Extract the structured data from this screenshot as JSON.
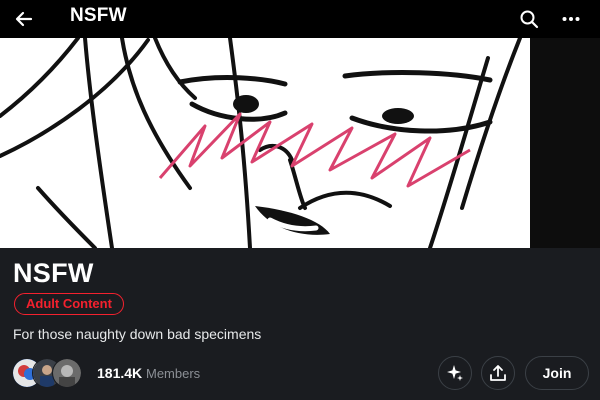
{
  "header": {
    "title": "NSFW",
    "back_icon": "arrow-left-icon",
    "search_icon": "search-icon",
    "more_icon": "more-horizontal-icon"
  },
  "community": {
    "name": "NSFW",
    "badge": "Adult Content",
    "description": "For those naughty down bad specimens",
    "member_count": "181.4K",
    "member_label": "Members",
    "join_label": "Join"
  },
  "actions": {
    "sparkle_icon": "sparkle-icon",
    "share_icon": "share-icon"
  },
  "colors": {
    "badge": "#f4212e",
    "background": "#1a1c20",
    "blush": "#d9416e"
  }
}
